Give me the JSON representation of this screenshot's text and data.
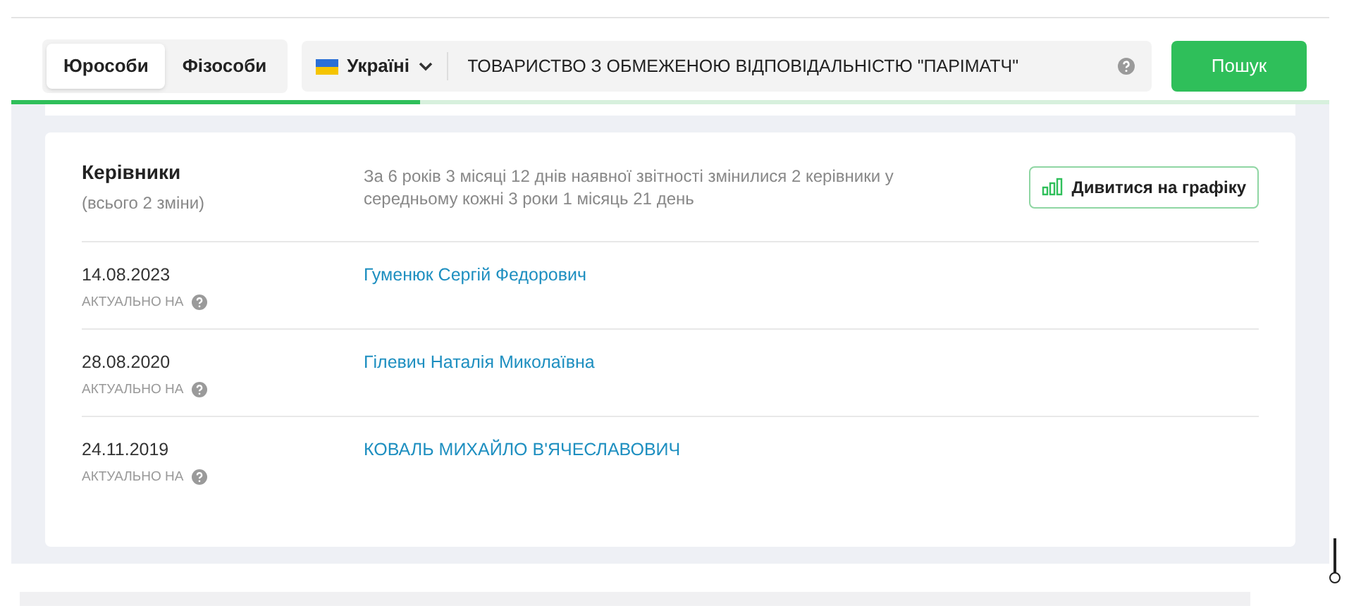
{
  "search_bar": {
    "tabs": [
      {
        "label": "Юрособи",
        "selected": true
      },
      {
        "label": "Фізособи",
        "selected": false
      }
    ],
    "country": "Україні",
    "query": "ТОВАРИСТВО З ОБМЕЖЕНОЮ ВІДПОВІДАЛЬНІСТЮ \"ПАРІМАТЧ\"",
    "button": "Пошук"
  },
  "progress": {
    "level": 0.31
  },
  "directors": {
    "title": "Керівники",
    "subtitle": "(всього 2 зміни)",
    "summary": "За 6 років 3 місяці 12 днів наявної звітності змінилися 2 керівники у середньому кожні 3 роки 1 місяць 21 день",
    "chart_button": "Дивитися на графіку",
    "rows": [
      {
        "date": "14.08.2023",
        "note": "АКТУАЛЬНО НА",
        "name": "Гуменюк Сергій Федорович"
      },
      {
        "date": "28.08.2020",
        "note": "АКТУАЛЬНО НА",
        "name": "Гілевич Наталія Миколаївна"
      },
      {
        "date": "24.11.2019",
        "note": "АКТУАЛЬНО НА",
        "name": "КОВАЛЬ МИХАЙЛО В'ЯЧЕСЛАВОВИЧ"
      }
    ]
  }
}
